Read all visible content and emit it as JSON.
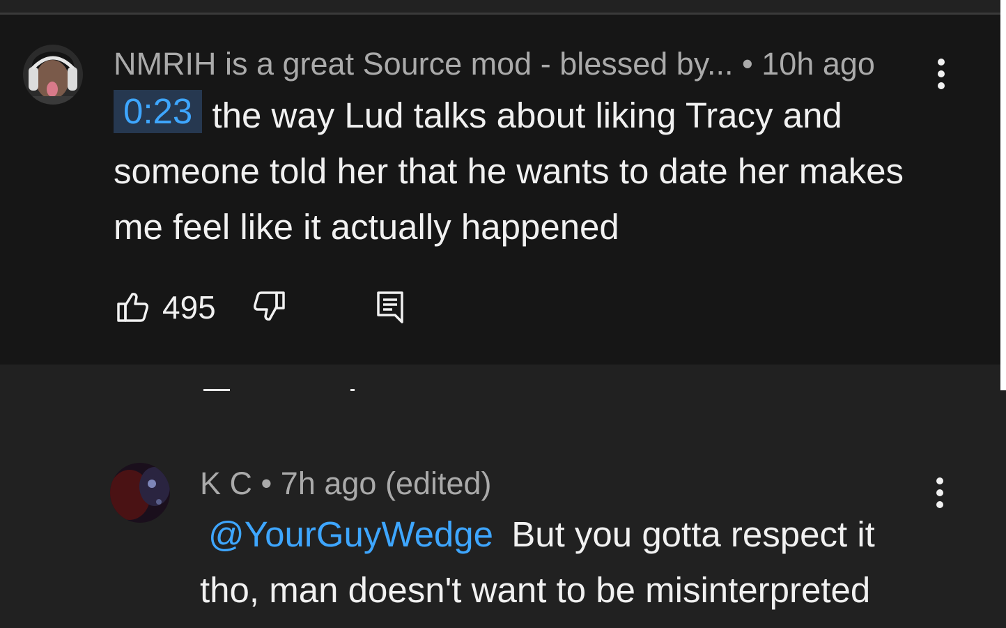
{
  "main_comment": {
    "author": "NMRIH is a great Source mod - blessed by...",
    "time": "10h ago",
    "timestamp_link": "0:23",
    "text": "the way Lud talks about liking Tracy and someone told her that he wants to date her makes me feel like it actually happened",
    "like_count": "495",
    "icons": {
      "menu": "more-vertical-icon",
      "like": "thumbs-up-icon",
      "dislike": "thumbs-down-icon",
      "reply": "reply-icon"
    }
  },
  "reply_comment": {
    "author": "K C",
    "time": "7h ago",
    "edited": "(edited)",
    "mention": "@YourGuyWedge",
    "text": "But you gotta respect it tho, man doesn't want to be misinterpreted",
    "icons": {
      "menu": "more-vertical-icon"
    }
  },
  "colors": {
    "background": "#212121",
    "comment_background": "#161616",
    "link_blue": "#3ea6ff",
    "timestamp_chip": "#263850",
    "meta_text": "#aaaaaa"
  }
}
